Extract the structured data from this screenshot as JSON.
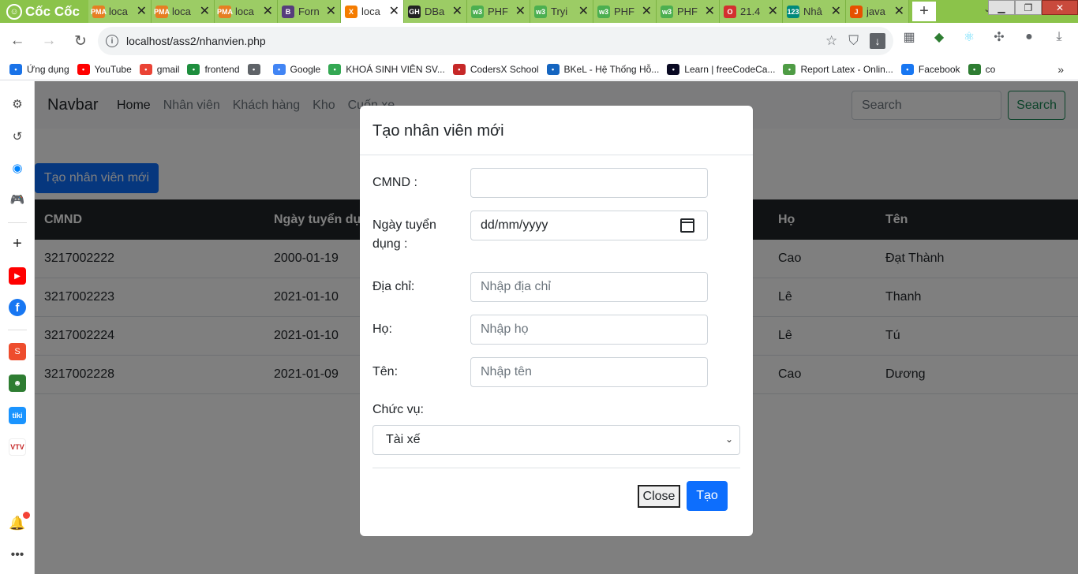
{
  "browser": {
    "brand": "Cốc Cốc",
    "tabs": [
      {
        "label": "loca",
        "icon": "PMA",
        "color": "#e67e22"
      },
      {
        "label": "loca",
        "icon": "PMA",
        "color": "#e67e22"
      },
      {
        "label": "loca",
        "icon": "PMA",
        "color": "#e67e22"
      },
      {
        "label": "Forn",
        "icon": "B",
        "color": "#563d7c"
      },
      {
        "label": "loca",
        "icon": "X",
        "color": "#f57c00"
      },
      {
        "label": "DBa",
        "icon": "GH",
        "color": "#222222"
      },
      {
        "label": "PHF",
        "icon": "w3",
        "color": "#4caf50"
      },
      {
        "label": "Tryi",
        "icon": "w3",
        "color": "#4caf50"
      },
      {
        "label": "PHF",
        "icon": "w3",
        "color": "#4caf50"
      },
      {
        "label": "PHF",
        "icon": "w3",
        "color": "#4caf50"
      },
      {
        "label": "21.4",
        "icon": "O",
        "color": "#d32f2f"
      },
      {
        "label": "Nhâ",
        "icon": "123",
        "color": "#00897b"
      },
      {
        "label": "java",
        "icon": "J",
        "color": "#e65100"
      }
    ],
    "active_tab_index": 4,
    "url": "localhost/ass2/nhanvien.php",
    "bookmarks": [
      {
        "label": "Ứng dụng",
        "icon": "apps-icon",
        "color": "#1a73e8"
      },
      {
        "label": "YouTube",
        "icon": "youtube-icon",
        "color": "#ff0000"
      },
      {
        "label": "gmail",
        "icon": "gmail-icon",
        "color": "#ea4335"
      },
      {
        "label": "frontend",
        "icon": "classroom-icon",
        "color": "#1e8e3e"
      },
      {
        "label": "",
        "icon": "globe-icon",
        "color": "#5f6368"
      },
      {
        "label": "Google",
        "icon": "google-icon",
        "color": "#4285f4"
      },
      {
        "label": "KHOÁ SINH VIÊN SV...",
        "icon": "drive-icon",
        "color": "#34a853"
      },
      {
        "label": "CodersX School",
        "icon": "codersx-icon",
        "color": "#c62828"
      },
      {
        "label": "BKeL - Hệ Thống Hỗ...",
        "icon": "bkel-icon",
        "color": "#1565c0"
      },
      {
        "label": "Learn | freeCodeCa...",
        "icon": "freecodecamp-icon",
        "color": "#0a0a23"
      },
      {
        "label": "Report Latex - Onlin...",
        "icon": "overleaf-icon",
        "color": "#4f9c45"
      },
      {
        "label": "Facebook",
        "icon": "facebook-icon",
        "color": "#1877f2"
      },
      {
        "label": "co",
        "icon": "image-icon",
        "color": "#2e7d32"
      }
    ]
  },
  "navbar": {
    "brand": "Navbar",
    "links": [
      "Home",
      "Nhân viên",
      "Khách hàng",
      "Kho",
      "Cuốn xe"
    ],
    "search_placeholder": "Search",
    "search_button": "Search"
  },
  "page": {
    "create_button": "Tạo nhân viên mới",
    "table": {
      "headers": [
        "CMND",
        "Ngày tuyển dụ",
        "Họ",
        "Tên"
      ],
      "rows": [
        [
          "3217002222",
          "2000-01-19",
          "Cao",
          "Đạt Thành"
        ],
        [
          "3217002223",
          "2021-01-10",
          "Lê",
          "Thanh"
        ],
        [
          "3217002224",
          "2021-01-10",
          "Lê",
          "Tú"
        ],
        [
          "3217002228",
          "2021-01-09",
          "Cao",
          "Dương"
        ]
      ]
    }
  },
  "modal": {
    "title": "Tạo nhân viên mới",
    "fields": {
      "cmnd_label": "CMND :",
      "cmnd_value": "",
      "ngay_label_line1": "Ngày tuyển",
      "ngay_label_line2": "dụng :",
      "ngay_placeholder": "dd/mm/yyyy",
      "diachi_label": "Địa chỉ:",
      "diachi_placeholder": "Nhập địa chỉ",
      "ho_label": "Họ:",
      "ho_placeholder": "Nhập họ",
      "ten_label": "Tên:",
      "ten_placeholder": "Nhập tên",
      "chucvu_label": "Chức vụ:",
      "chucvu_selected": "Tài xế"
    },
    "close_button": "Close",
    "submit_button": "Tạo"
  }
}
